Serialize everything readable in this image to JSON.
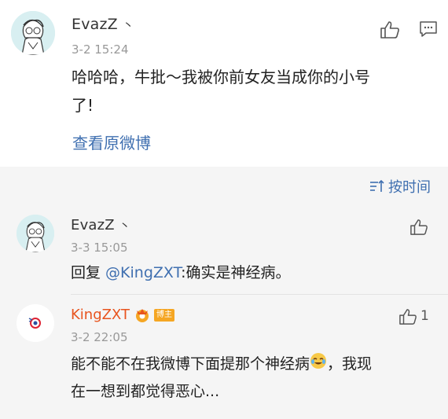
{
  "main_comment": {
    "username": "EvazZ",
    "username_suffix": "丶",
    "time": "3-2 15:24",
    "text_line1": "哈哈哈，牛批～我被你前女友当成你的小号",
    "text_line2": "了!",
    "view_original": "查看原微博"
  },
  "sort": {
    "label": "按时间",
    "icon": "sort-icon"
  },
  "replies": [
    {
      "username": "EvazZ",
      "username_suffix": "丶",
      "time": "3-3 15:05",
      "text_prefix": "回复 ",
      "mention": "@KingZXT",
      "text_rest": ":确实是神经病。",
      "like_count": ""
    },
    {
      "username": "KingZXT",
      "badge": "博主",
      "time": "3-2 22:05",
      "text_line1": "能不能不在我微博下面提那个神经病",
      "emoji": "laugh-cry-emoji",
      "text_line1_end": "，我现",
      "text_line2": "在一想到都觉得恶心...",
      "like_count": "1"
    }
  ],
  "colors": {
    "link": "#3f6fb0",
    "blogger_name": "#e8541e",
    "gray_bg": "#f5f5f5"
  }
}
